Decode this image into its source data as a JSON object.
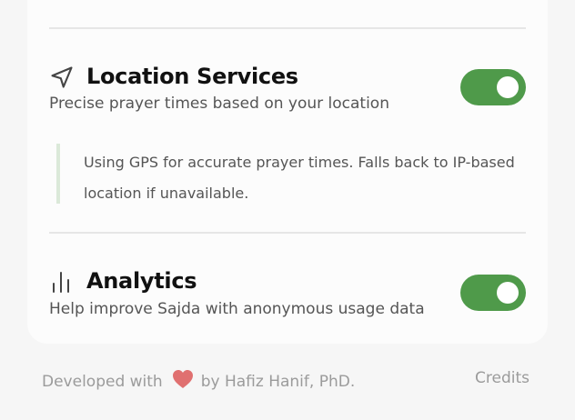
{
  "colors": {
    "toggle_on": "#4f9a4a",
    "heart": "#e07070",
    "note_border": "#dbe9d9"
  },
  "location": {
    "icon": "navigation-arrow-icon",
    "title": "Location Services",
    "description": "Precise prayer times based on your location",
    "enabled": true,
    "note": "Using GPS for accurate prayer times. Falls back to IP-based location if unavailable."
  },
  "analytics": {
    "icon": "bar-chart-icon",
    "title": "Analytics",
    "description": "Help improve Sajda with anonymous usage data",
    "enabled": true
  },
  "footer": {
    "developed_with": "Developed with",
    "heart_icon": "heart-icon",
    "author": "by Hafiz Hanif, PhD.",
    "credits": "Credits"
  }
}
